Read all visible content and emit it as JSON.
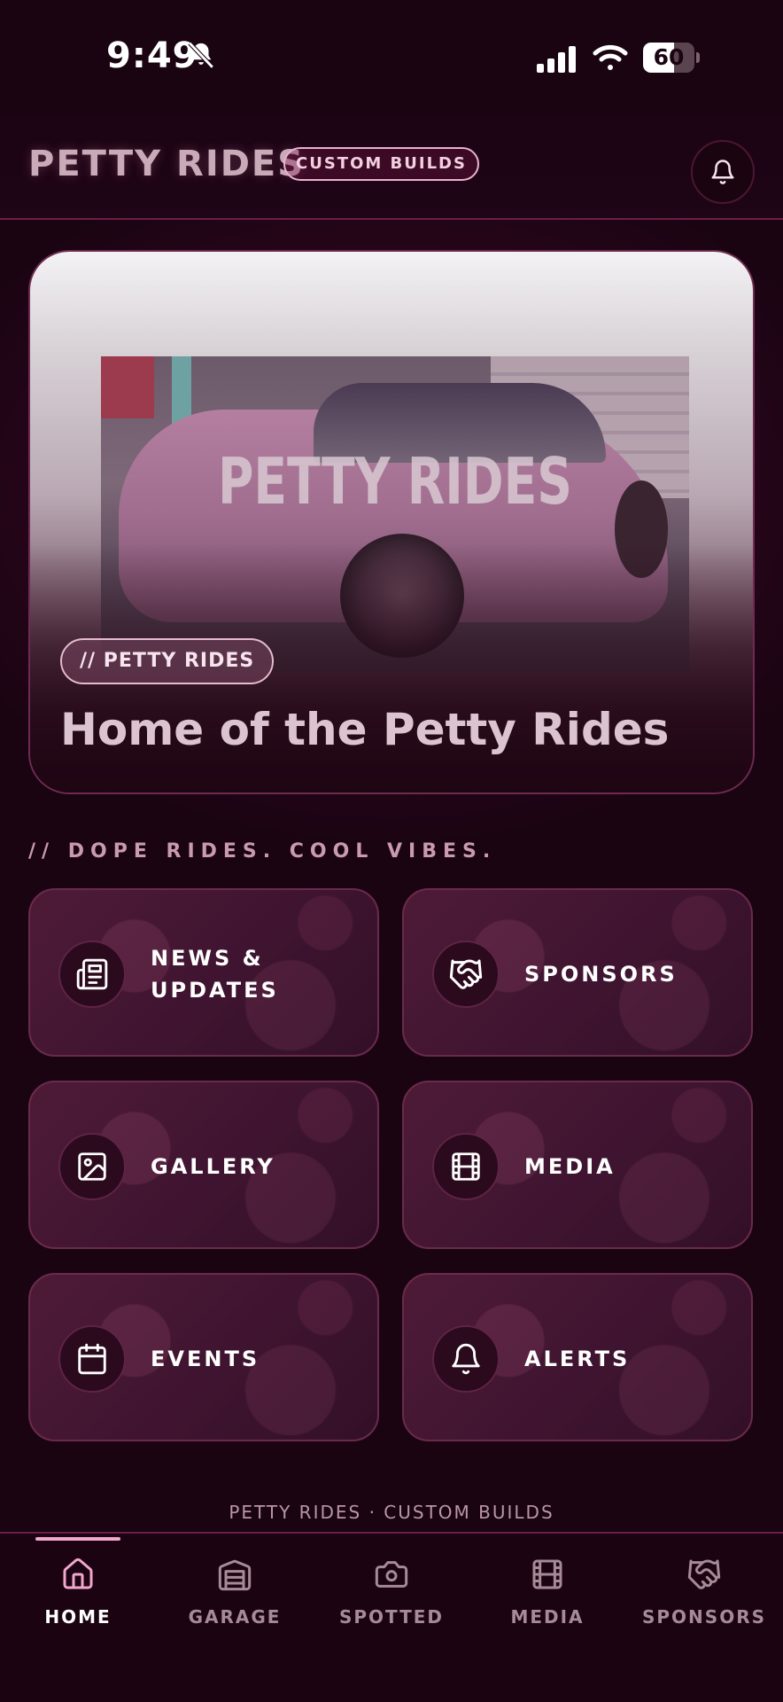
{
  "status_bar": {
    "time": "9:49",
    "battery": "60",
    "battery_level": 0.6
  },
  "header": {
    "brand": "PETTY RIDES",
    "pill": "CUSTOM BUILDS"
  },
  "hero": {
    "tag": "// PETTY RIDES",
    "title": "Home of the Petty Rides",
    "image_logo_text": "PETTY RIDES"
  },
  "tagline": "// DOPE RIDES. COOL VIBES.",
  "tiles": [
    {
      "label": "NEWS & UPDATES",
      "icon": "newspaper-icon"
    },
    {
      "label": "SPONSORS",
      "icon": "handshake-icon"
    },
    {
      "label": "GALLERY",
      "icon": "image-icon"
    },
    {
      "label": "MEDIA",
      "icon": "film-icon"
    },
    {
      "label": "EVENTS",
      "icon": "calendar-icon"
    },
    {
      "label": "ALERTS",
      "icon": "bell-icon"
    }
  ],
  "footer": "PETTY RIDES · CUSTOM BUILDS",
  "nav": [
    {
      "label": "HOME",
      "icon": "home-icon",
      "active": true
    },
    {
      "label": "GARAGE",
      "icon": "garage-icon",
      "active": false
    },
    {
      "label": "SPOTTED",
      "icon": "camera-icon",
      "active": false
    },
    {
      "label": "MEDIA",
      "icon": "film-icon",
      "active": false
    },
    {
      "label": "SPONSORS",
      "icon": "handshake-icon",
      "active": false
    }
  ],
  "colors": {
    "accent": "#f2a7cd",
    "background": "#1a0412",
    "tile": "#4e1b37"
  }
}
